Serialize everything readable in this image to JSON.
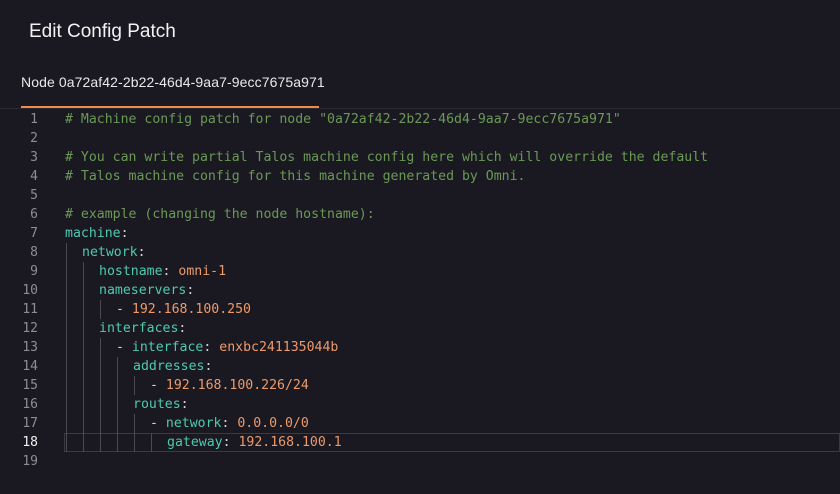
{
  "dialog": {
    "title": "Edit Config Patch"
  },
  "tabs": [
    {
      "label": "Node 0a72af42-2b22-46d4-9aa7-9ecc7675a971",
      "active": true
    }
  ],
  "editor": {
    "active_line": 18,
    "lines": [
      {
        "num": "1",
        "indent": 0,
        "tokens": [
          {
            "t": "comment",
            "v": "# Machine config patch for node \"0a72af42-2b22-46d4-9aa7-9ecc7675a971\""
          }
        ]
      },
      {
        "num": "2",
        "indent": 0,
        "tokens": []
      },
      {
        "num": "3",
        "indent": 0,
        "tokens": [
          {
            "t": "comment",
            "v": "# You can write partial Talos machine config here which will override the default"
          }
        ]
      },
      {
        "num": "4",
        "indent": 0,
        "tokens": [
          {
            "t": "comment",
            "v": "# Talos machine config for this machine generated by Omni."
          }
        ]
      },
      {
        "num": "5",
        "indent": 0,
        "tokens": []
      },
      {
        "num": "6",
        "indent": 0,
        "tokens": [
          {
            "t": "comment",
            "v": "# example (changing the node hostname):"
          }
        ]
      },
      {
        "num": "7",
        "indent": 0,
        "tokens": [
          {
            "t": "key",
            "v": "machine"
          },
          {
            "t": "punct",
            "v": ":"
          }
        ]
      },
      {
        "num": "8",
        "indent": 1,
        "tokens": [
          {
            "t": "key",
            "v": "network"
          },
          {
            "t": "punct",
            "v": ":"
          }
        ]
      },
      {
        "num": "9",
        "indent": 2,
        "tokens": [
          {
            "t": "key",
            "v": "hostname"
          },
          {
            "t": "punct",
            "v": ": "
          },
          {
            "t": "val",
            "v": "omni-1"
          }
        ]
      },
      {
        "num": "10",
        "indent": 2,
        "tokens": [
          {
            "t": "key",
            "v": "nameservers"
          },
          {
            "t": "punct",
            "v": ":"
          }
        ]
      },
      {
        "num": "11",
        "indent": 3,
        "tokens": [
          {
            "t": "punct",
            "v": "- "
          },
          {
            "t": "val",
            "v": "192.168.100.250"
          }
        ]
      },
      {
        "num": "12",
        "indent": 2,
        "tokens": [
          {
            "t": "key",
            "v": "interfaces"
          },
          {
            "t": "punct",
            "v": ":"
          }
        ]
      },
      {
        "num": "13",
        "indent": 3,
        "tokens": [
          {
            "t": "punct",
            "v": "- "
          },
          {
            "t": "key",
            "v": "interface"
          },
          {
            "t": "punct",
            "v": ": "
          },
          {
            "t": "val",
            "v": "enxbc241135044b"
          }
        ]
      },
      {
        "num": "14",
        "indent": 4,
        "tokens": [
          {
            "t": "key",
            "v": "addresses"
          },
          {
            "t": "punct",
            "v": ":"
          }
        ]
      },
      {
        "num": "15",
        "indent": 5,
        "tokens": [
          {
            "t": "punct",
            "v": "- "
          },
          {
            "t": "val",
            "v": "192.168.100.226/24"
          }
        ]
      },
      {
        "num": "16",
        "indent": 4,
        "tokens": [
          {
            "t": "key",
            "v": "routes"
          },
          {
            "t": "punct",
            "v": ":"
          }
        ]
      },
      {
        "num": "17",
        "indent": 5,
        "tokens": [
          {
            "t": "punct",
            "v": "- "
          },
          {
            "t": "key",
            "v": "network"
          },
          {
            "t": "punct",
            "v": ": "
          },
          {
            "t": "val",
            "v": "0.0.0.0/0"
          }
        ]
      },
      {
        "num": "18",
        "indent": 6,
        "tokens": [
          {
            "t": "key",
            "v": "gateway"
          },
          {
            "t": "punct",
            "v": ": "
          },
          {
            "t": "val",
            "v": "192.168.100.1"
          }
        ]
      },
      {
        "num": "19",
        "indent": 0,
        "tokens": []
      }
    ]
  }
}
